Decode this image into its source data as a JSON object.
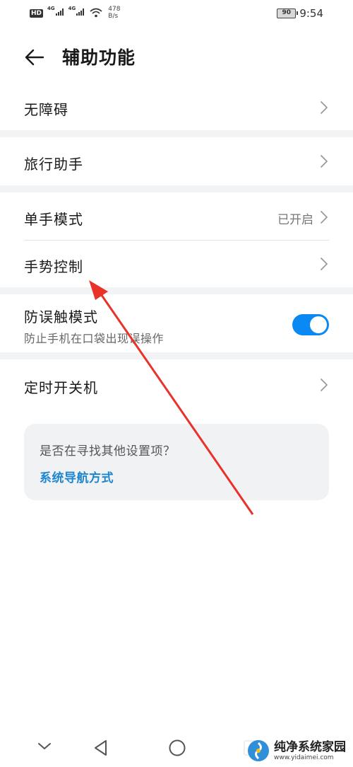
{
  "status_bar": {
    "hd_label": "HD",
    "signal1_label": "4G",
    "signal2_label": "4G",
    "net_speed_value": "478",
    "net_speed_unit": "B/s",
    "battery_level": "90",
    "time": "9:54"
  },
  "header": {
    "title": "辅助功能"
  },
  "settings": {
    "accessibility": {
      "label": "无障碍"
    },
    "travel_assistant": {
      "label": "旅行助手"
    },
    "one_hand_mode": {
      "label": "单手模式",
      "value": "已开启"
    },
    "gesture_control": {
      "label": "手势控制"
    },
    "accidental_touch": {
      "label": "防误触模式",
      "description": "防止手机在口袋出现误操作",
      "enabled": true
    },
    "scheduled_power": {
      "label": "定时开关机"
    }
  },
  "hint": {
    "question": "是否在寻找其他设置项？",
    "link": "系统导航方式"
  },
  "watermark": {
    "title": "纯净系统家园",
    "url": "www.yidaimei.com"
  },
  "colors": {
    "accent": "#0a88f3",
    "link": "#1e86cf",
    "annotation_arrow": "#e8322a",
    "separator": "#f1f3f5"
  }
}
